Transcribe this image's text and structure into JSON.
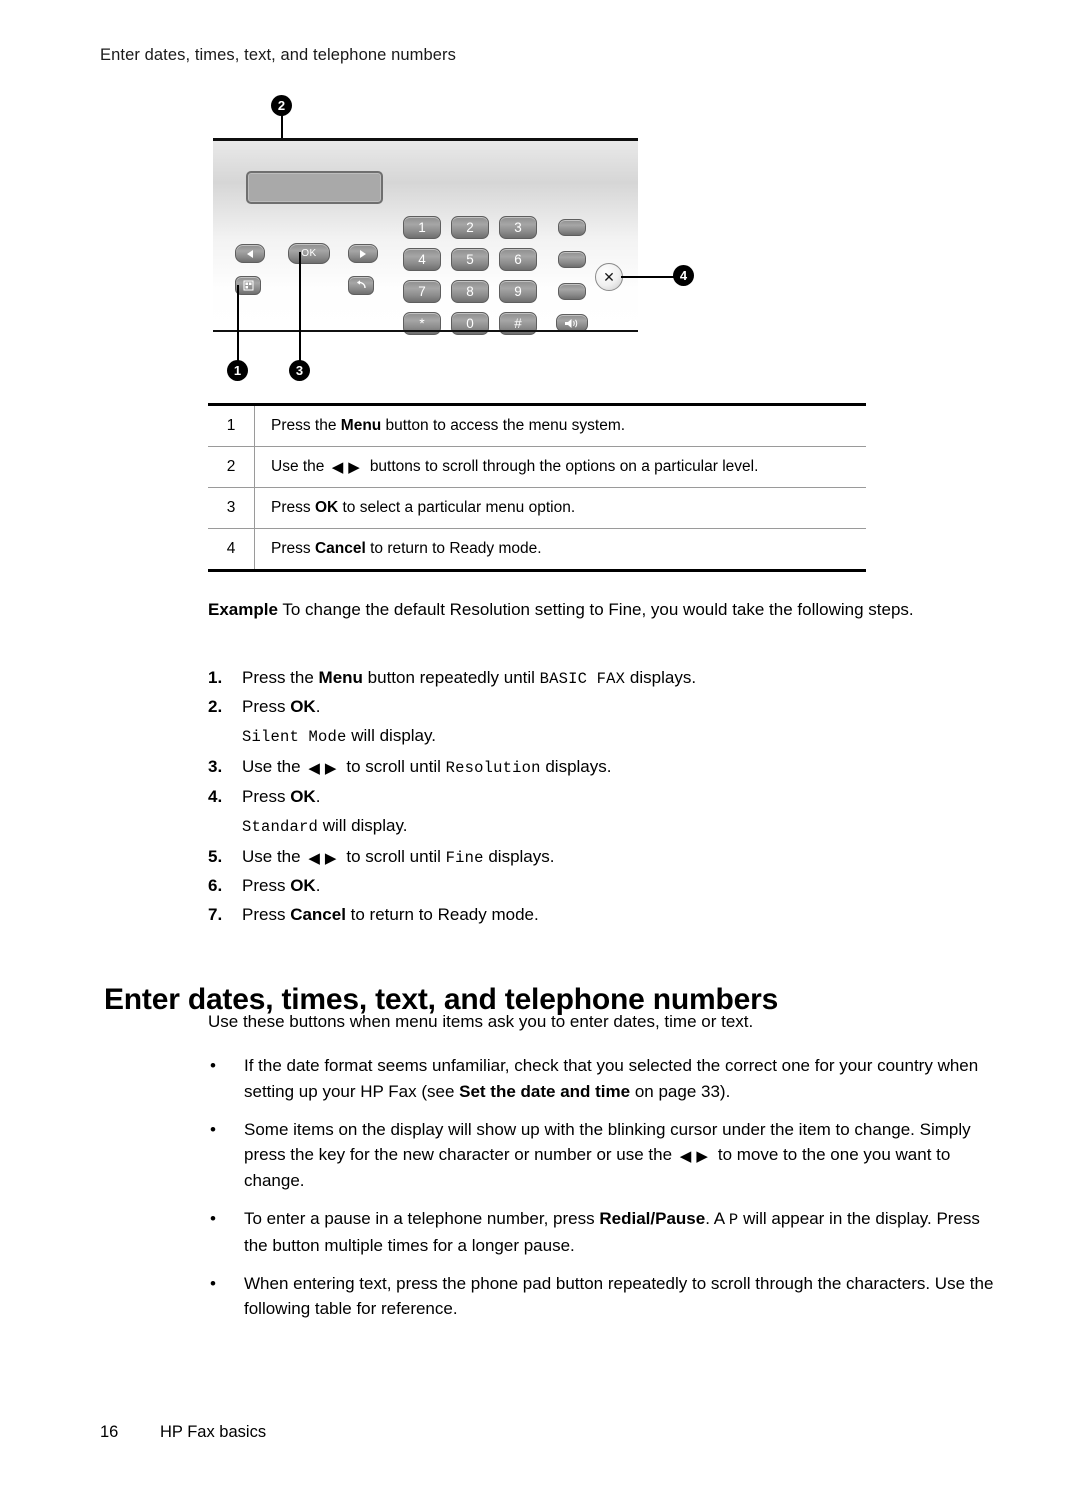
{
  "running_header": "Enter dates, times, text, and telephone numbers",
  "figure": {
    "callouts": [
      {
        "id": "1",
        "label": "1"
      },
      {
        "id": "2",
        "label": "2"
      },
      {
        "id": "3",
        "label": "3"
      },
      {
        "id": "4",
        "label": "4"
      }
    ],
    "keys": {
      "ok": "OK",
      "keypad": [
        "1",
        "2",
        "3",
        "4",
        "5",
        "6",
        "7",
        "8",
        "9",
        "*",
        "0",
        "#"
      ]
    }
  },
  "ref_table": {
    "rows": [
      {
        "index": "1",
        "pre": "Press the ",
        "bold": "Menu",
        "post": " button to access the menu system.",
        "arrows": false
      },
      {
        "index": "2",
        "pre": "Use the ",
        "bold": "",
        "post": "buttons to scroll through the options on a particular level.",
        "arrows": true
      },
      {
        "index": "3",
        "pre": "Press ",
        "bold": "OK",
        "post": " to select a particular menu option.",
        "arrows": false
      },
      {
        "index": "4",
        "pre": "Press ",
        "bold": "Cancel",
        "post": " to return to Ready mode.",
        "arrows": false
      }
    ]
  },
  "example": {
    "lead_bold": "Example",
    "lead_text": " To change the default Resolution setting to Fine, you would take the following steps.",
    "steps": [
      {
        "num": "1.",
        "parts": [
          {
            "t": "Press the ",
            "s": "plain"
          },
          {
            "t": "Menu",
            "s": "bold"
          },
          {
            "t": " button repeatedly until ",
            "s": "plain"
          },
          {
            "t": "BASIC FAX",
            "s": "mono"
          },
          {
            "t": " displays.",
            "s": "plain"
          }
        ]
      },
      {
        "num": "2.",
        "parts": [
          {
            "t": "Press ",
            "s": "plain"
          },
          {
            "t": "OK",
            "s": "bold"
          },
          {
            "t": ".",
            "s": "plain"
          }
        ],
        "sub": [
          {
            "t": "Silent Mode",
            "s": "mono"
          },
          {
            "t": " will display.",
            "s": "plain"
          }
        ]
      },
      {
        "num": "3.",
        "parts": [
          {
            "t": "Use the ",
            "s": "plain"
          },
          {
            "t": "ARROWS",
            "s": "arrows"
          },
          {
            "t": "to scroll until ",
            "s": "plain"
          },
          {
            "t": "Resolution",
            "s": "mono"
          },
          {
            "t": " displays.",
            "s": "plain"
          }
        ]
      },
      {
        "num": "4.",
        "parts": [
          {
            "t": "Press ",
            "s": "plain"
          },
          {
            "t": "OK",
            "s": "bold"
          },
          {
            "t": ".",
            "s": "plain"
          }
        ],
        "sub": [
          {
            "t": "Standard",
            "s": "mono"
          },
          {
            "t": " will display.",
            "s": "plain"
          }
        ]
      },
      {
        "num": "5.",
        "parts": [
          {
            "t": "Use the ",
            "s": "plain"
          },
          {
            "t": "ARROWS",
            "s": "arrows"
          },
          {
            "t": "to scroll until ",
            "s": "plain"
          },
          {
            "t": "Fine",
            "s": "mono"
          },
          {
            "t": " displays.",
            "s": "plain"
          }
        ]
      },
      {
        "num": "6.",
        "parts": [
          {
            "t": "Press ",
            "s": "plain"
          },
          {
            "t": "OK",
            "s": "bold"
          },
          {
            "t": ".",
            "s": "plain"
          }
        ]
      },
      {
        "num": "7.",
        "parts": [
          {
            "t": "Press ",
            "s": "plain"
          },
          {
            "t": "Cancel",
            "s": "bold"
          },
          {
            "t": " to return to Ready mode.",
            "s": "plain"
          }
        ]
      }
    ]
  },
  "heading": "Enter dates, times, text, and telephone numbers",
  "intro": "Use these buttons when menu items ask you to enter dates, time or text.",
  "bullets": [
    {
      "parts": [
        {
          "t": "If the date format seems unfamiliar, check that you selected the correct one for your country when setting up your HP Fax (see ",
          "s": "plain"
        },
        {
          "t": "Set the date and time",
          "s": "bold"
        },
        {
          "t": " on page 33).",
          "s": "plain"
        }
      ]
    },
    {
      "parts": [
        {
          "t": "Some items on the display will show up with the blinking cursor under the item to change. Simply press the key for the new character or number or use the ",
          "s": "plain"
        },
        {
          "t": "ARROWS",
          "s": "arrows"
        },
        {
          "t": "to move to the one you want to change.",
          "s": "plain"
        }
      ]
    },
    {
      "parts": [
        {
          "t": "To enter a pause in a telephone number, press ",
          "s": "plain"
        },
        {
          "t": "Redial/Pause",
          "s": "bold"
        },
        {
          "t": ". A ",
          "s": "plain"
        },
        {
          "t": "P",
          "s": "mono"
        },
        {
          "t": " will appear in the display. Press the button multiple times for a longer pause.",
          "s": "plain"
        }
      ]
    },
    {
      "parts": [
        {
          "t": "When entering text, press the phone pad button repeatedly to scroll through the characters. Use the following table for reference.",
          "s": "plain"
        }
      ]
    }
  ],
  "footer": {
    "page_number": "16",
    "section": "HP Fax basics"
  }
}
